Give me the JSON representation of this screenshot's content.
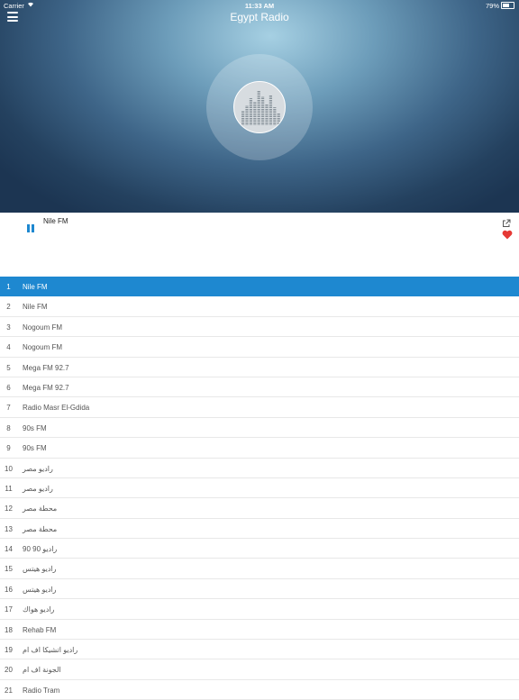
{
  "status_bar": {
    "carrier": "Carrier",
    "time": "11:33 AM",
    "battery": "79%",
    "battery_level": 0.79
  },
  "header": {
    "title": "Egypt Radio"
  },
  "now_playing": {
    "station": "Nile FM",
    "state": "playing",
    "favorite": true
  },
  "stations": [
    {
      "num": "1",
      "name": "Nile FM",
      "active": true
    },
    {
      "num": "2",
      "name": "Nile FM"
    },
    {
      "num": "3",
      "name": "Nogoum FM"
    },
    {
      "num": "4",
      "name": "Nogoum FM"
    },
    {
      "num": "5",
      "name": "Mega FM 92.7"
    },
    {
      "num": "6",
      "name": "Mega FM 92.7"
    },
    {
      "num": "7",
      "name": "Radio Masr El-Gdida"
    },
    {
      "num": "8",
      "name": "90s FM"
    },
    {
      "num": "9",
      "name": "90s FM"
    },
    {
      "num": "10",
      "name": "راديو مصر"
    },
    {
      "num": "11",
      "name": "راديو مصر"
    },
    {
      "num": "12",
      "name": "محطة مصر"
    },
    {
      "num": "13",
      "name": "محطة مصر"
    },
    {
      "num": "14",
      "name": "راديو 90 90"
    },
    {
      "num": "15",
      "name": "راديو هيتس"
    },
    {
      "num": "16",
      "name": "راديو هيتس"
    },
    {
      "num": "17",
      "name": "راديو هواك"
    },
    {
      "num": "18",
      "name": "Rehab FM"
    },
    {
      "num": "19",
      "name": "راديو اتشيكا اف ام"
    },
    {
      "num": "20",
      "name": "الجونة اف ام"
    },
    {
      "num": "21",
      "name": "Radio Tram"
    }
  ],
  "colors": {
    "accent": "#1e88d0",
    "favorite": "#e53935"
  },
  "icons": {
    "menu": "hamburger-icon",
    "artwork": "equalizer-icon",
    "pause": "pause-icon",
    "share": "share-icon",
    "favorite": "heart-icon"
  }
}
